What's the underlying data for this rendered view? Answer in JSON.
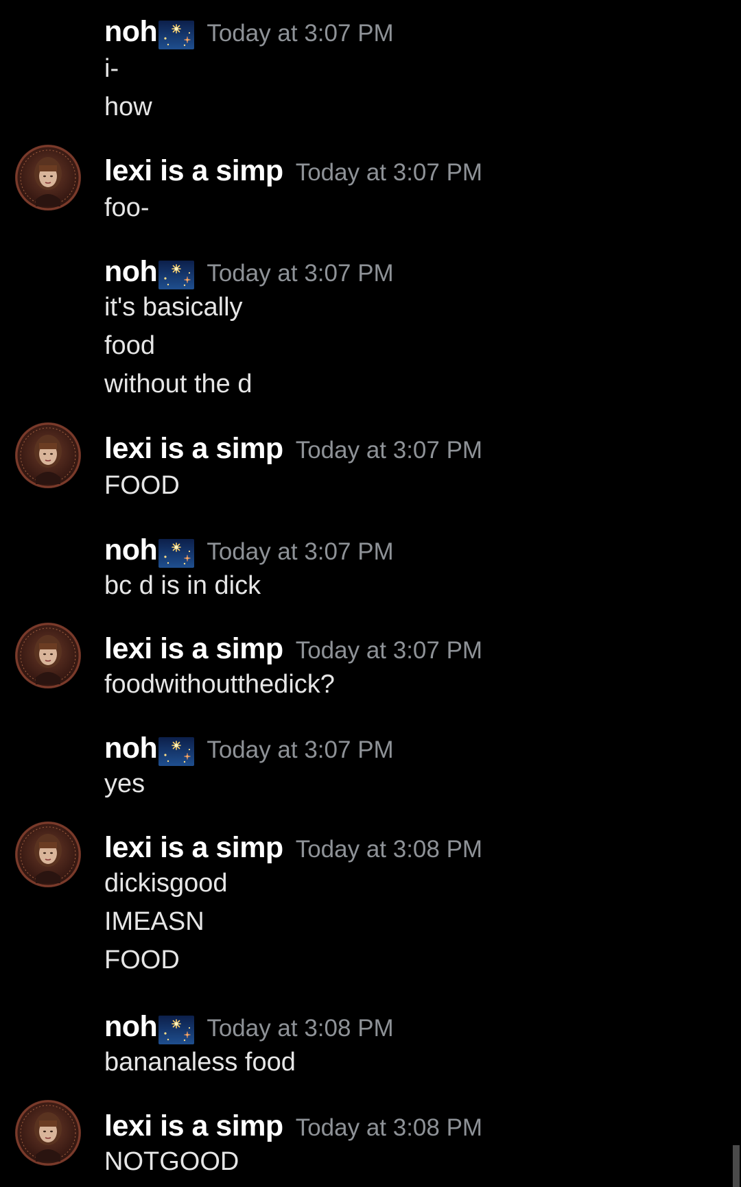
{
  "messages": [
    {
      "author": "noh",
      "has_avatar": false,
      "timestamp": "Today at 3:07 PM",
      "lines": [
        "i-",
        "how"
      ]
    },
    {
      "author": "lexi is a simp",
      "has_avatar": true,
      "timestamp": "Today at 3:07 PM",
      "lines": [
        "foo-"
      ]
    },
    {
      "author": "noh",
      "has_avatar": false,
      "timestamp": "Today at 3:07 PM",
      "lines": [
        "it's basically",
        "food",
        "without the d"
      ]
    },
    {
      "author": "lexi is a simp",
      "has_avatar": true,
      "timestamp": "Today at 3:07 PM",
      "lines": [
        "FOOD"
      ]
    },
    {
      "author": "noh",
      "has_avatar": false,
      "timestamp": "Today at 3:07 PM",
      "lines": [
        "bc d is in dick"
      ]
    },
    {
      "author": "lexi is a simp",
      "has_avatar": true,
      "timestamp": "Today at 3:07 PM",
      "lines": [
        "foodwithoutthedick?"
      ]
    },
    {
      "author": "noh",
      "has_avatar": false,
      "timestamp": "Today at 3:07 PM",
      "lines": [
        "yes"
      ]
    },
    {
      "author": "lexi is a simp",
      "has_avatar": true,
      "timestamp": "Today at 3:08 PM",
      "lines": [
        "dickisgood",
        "IMEASN",
        "FOOD"
      ]
    },
    {
      "author": "noh",
      "has_avatar": false,
      "timestamp": "Today at 3:08 PM",
      "lines": [
        "bananaless food"
      ]
    },
    {
      "author": "lexi is a simp",
      "has_avatar": true,
      "timestamp": "Today at 3:08 PM",
      "lines": [
        "NOTGOOD"
      ]
    }
  ],
  "icons": {
    "noh_badge": "sparkler-fireworks-icon",
    "lexi_avatar": "user-avatar-portrait"
  },
  "colors": {
    "background": "#000000",
    "username": "#ffffff",
    "timestamp": "#8e9297",
    "message_text": "#e6e6e6"
  }
}
